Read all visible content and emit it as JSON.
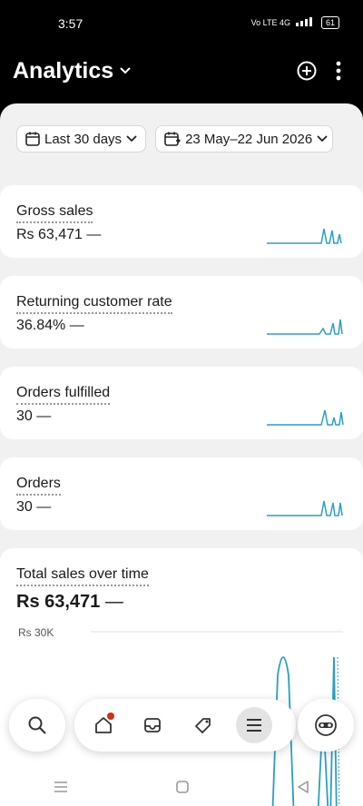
{
  "status_bar": {
    "time": "3:57",
    "network": "Vo LTE 4G",
    "battery": "61"
  },
  "header": {
    "title": "Analytics"
  },
  "filters": {
    "range": "Last 30 days",
    "dates": "23 May–22 Jun 2026"
  },
  "metrics": [
    {
      "label": "Gross sales",
      "value": "Rs 63,471",
      "change": "—"
    },
    {
      "label": "Returning customer rate",
      "value": "36.84%",
      "change": "—"
    },
    {
      "label": "Orders fulfilled",
      "value": "30",
      "change": "—"
    },
    {
      "label": "Orders",
      "value": "30",
      "change": "—"
    }
  ],
  "total_sales": {
    "title": "Total sales over time",
    "value": "Rs 63,471",
    "change": "—",
    "axis_top": "Rs 30K"
  },
  "colors": {
    "accent": "#2a9fc4",
    "background": "#f1f1f1",
    "notification": "#d72c0d"
  },
  "icons": {
    "title_chevron": "chevron-down-icon",
    "add": "plus-circle-icon",
    "more": "more-vertical-icon",
    "calendar": "calendar-icon",
    "compare": "calendar-compare-icon",
    "nav": [
      "search-icon",
      "home-icon",
      "inbox-icon",
      "tag-icon",
      "menu-icon",
      "app-icon"
    ]
  }
}
